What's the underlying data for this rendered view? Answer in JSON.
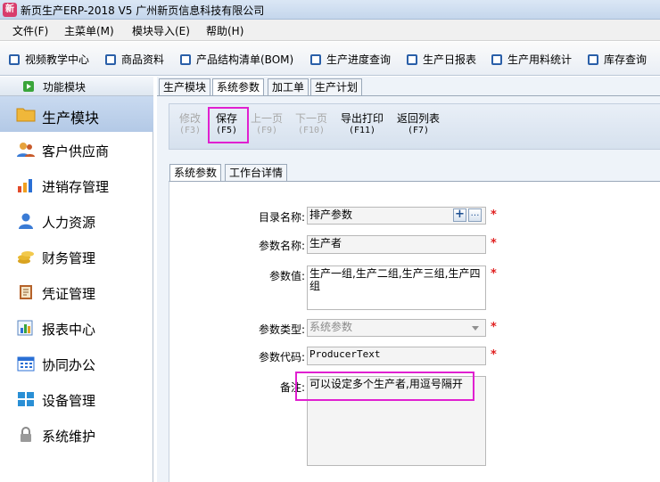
{
  "window": {
    "title": "新页生产ERP-2018 V5 广州新页信息科技有限公司",
    "icon": "app-logo-icon"
  },
  "menubar": [
    {
      "label": "文件(F)"
    },
    {
      "label": "主菜单(M)"
    },
    {
      "label": "模块导入(E)"
    },
    {
      "label": "帮助(H)"
    }
  ],
  "toolbar": [
    {
      "label": "视频教学中心",
      "icon": "checkbox-icon"
    },
    {
      "label": "商品资料",
      "icon": "checkbox-icon"
    },
    {
      "label": "产品结构清单(BOM)",
      "icon": "checkbox-icon"
    },
    {
      "label": "生产进度查询",
      "icon": "checkbox-icon"
    },
    {
      "label": "生产日报表",
      "icon": "checkbox-icon"
    },
    {
      "label": "生产用料统计",
      "icon": "checkbox-icon"
    },
    {
      "label": "库存查询",
      "icon": "checkbox-icon"
    }
  ],
  "sidebar": {
    "header": "功能模块",
    "items": [
      {
        "label": "生产模块",
        "icon": "folder-icon",
        "active": true
      },
      {
        "label": "客户供应商",
        "icon": "users-icon"
      },
      {
        "label": "进销存管理",
        "icon": "bar-chart-icon"
      },
      {
        "label": "人力资源",
        "icon": "person-icon"
      },
      {
        "label": "财务管理",
        "icon": "coins-icon"
      },
      {
        "label": "凭证管理",
        "icon": "notebook-icon"
      },
      {
        "label": "报表中心",
        "icon": "report-icon"
      },
      {
        "label": "协同办公",
        "icon": "calendar-icon"
      },
      {
        "label": "设备管理",
        "icon": "windows-icon"
      },
      {
        "label": "系统维护",
        "icon": "lock-icon"
      }
    ]
  },
  "tabs": [
    {
      "label": "生产模块"
    },
    {
      "label": "系统参数",
      "active": true
    },
    {
      "label": "加工单"
    },
    {
      "label": "生产计划"
    }
  ],
  "commands": [
    {
      "label": "修改",
      "key": "(F3)",
      "enabled": false
    },
    {
      "label": "保存",
      "key": "(F5)",
      "enabled": true,
      "highlighted": true
    },
    {
      "label": "上一页",
      "key": "(F9)",
      "enabled": false
    },
    {
      "label": "下一页",
      "key": "(F10)",
      "enabled": false
    },
    {
      "label": "导出打印",
      "key": "(F11)",
      "enabled": true
    },
    {
      "label": "返回列表",
      "key": "(F7)",
      "enabled": true
    }
  ],
  "inner_tabs": [
    {
      "label": "系统参数",
      "active": true
    },
    {
      "label": "工作台详情"
    }
  ],
  "form": {
    "catalog": {
      "label": "目录名称:",
      "value": "排产参数"
    },
    "name": {
      "label": "参数名称:",
      "value": "生产者"
    },
    "value": {
      "label": "参数值:",
      "value": "生产一组,生产二组,生产三组,生产四组"
    },
    "type": {
      "label": "参数类型:",
      "value": "系统参数"
    },
    "code": {
      "label": "参数代码:",
      "value": "ProducerText"
    },
    "remark": {
      "label": "备注:",
      "value": "可以设定多个生产者,用逗号隔开"
    }
  },
  "colors": {
    "highlight": "#e020d0",
    "required": "#e02020",
    "active_side": "#b3c9e6"
  }
}
